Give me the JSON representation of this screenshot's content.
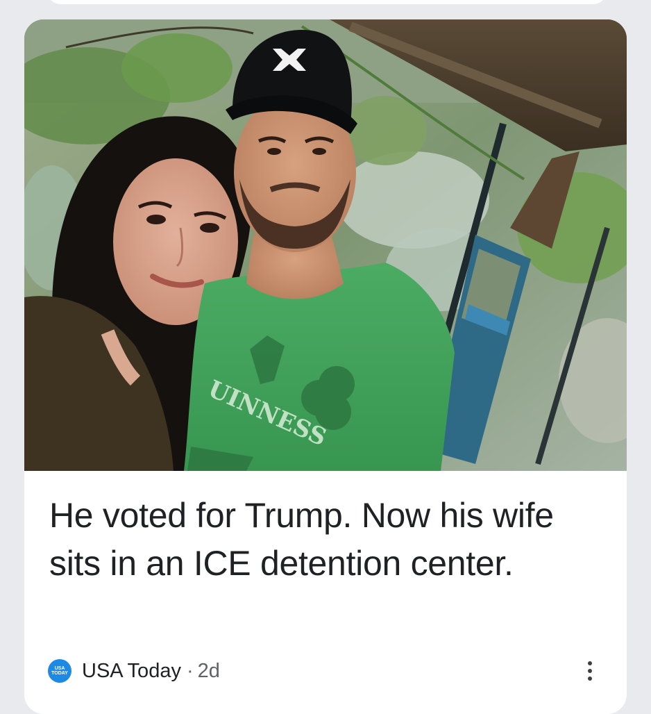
{
  "article": {
    "headline": "He voted for Trump. Now his wife sits in an ICE detention center.",
    "source_name": "USA Today",
    "separator": "·",
    "time_ago": "2d",
    "source_logo_text": [
      "USA",
      "TODAY"
    ],
    "shirt_text": "UINNESS",
    "more_icon": "more-vert-icon"
  },
  "colors": {
    "background": "#e8eaed",
    "card": "#ffffff",
    "headline_text": "#202124",
    "meta_text": "#5f6368",
    "usa_today_blue": "#1e88e5"
  }
}
